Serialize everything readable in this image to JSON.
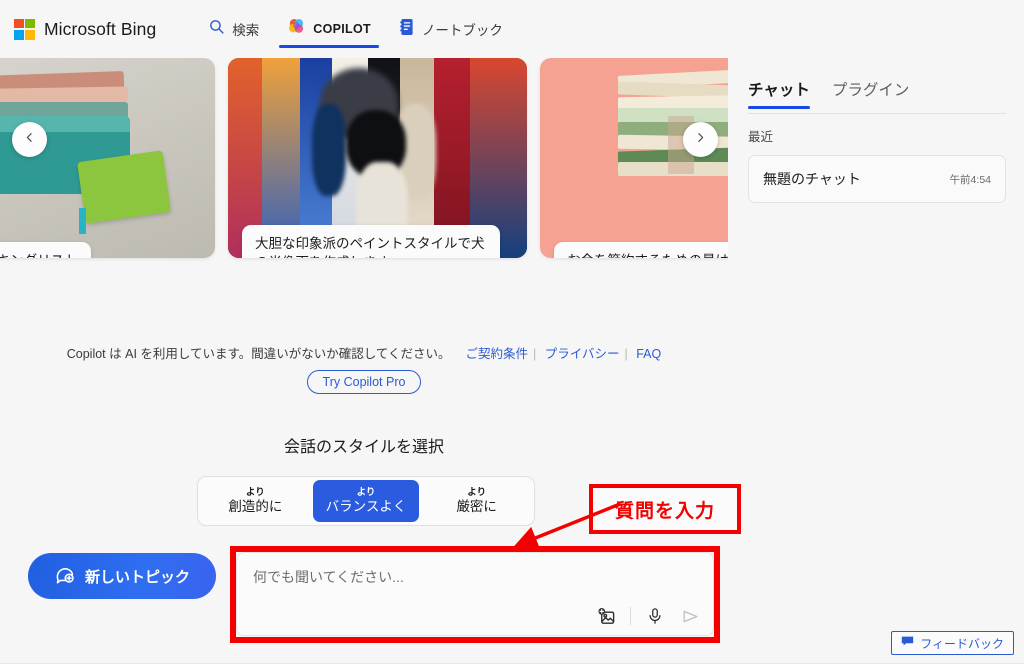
{
  "header": {
    "brand": "Microsoft Bing",
    "tabs": [
      {
        "label": "検索",
        "icon": "search-icon",
        "active": false
      },
      {
        "label": "COPILOT",
        "icon": "copilot-icon",
        "active": true
      },
      {
        "label": "ノートブック",
        "icon": "notebook-icon",
        "active": false
      }
    ]
  },
  "carousel": {
    "prev_icon": "chevron-left-icon",
    "next_icon": "chevron-right-icon",
    "cards": [
      {
        "caption": "行のパッキングリスト",
        "art": "books-desk"
      },
      {
        "caption": "大胆な印象派のペイントスタイルで犬の肖像画を作成します",
        "art": "impressionist-painting"
      },
      {
        "caption": "お金を節約するための最は何ですか",
        "art": "money-stack"
      }
    ]
  },
  "right_panel": {
    "tabs": [
      {
        "label": "チャット",
        "active": true
      },
      {
        "label": "プラグイン",
        "active": false
      }
    ],
    "recent_label": "最近",
    "chats": [
      {
        "title": "無題のチャット",
        "time": "午前4:54"
      }
    ]
  },
  "disclaimer": {
    "text": "Copilot は AI を利用しています。間違いがないか確認してください。",
    "links": [
      "ご契約条件",
      "プライバシー",
      "FAQ"
    ],
    "pro_button": "Try Copilot Pro"
  },
  "style_picker": {
    "title": "会話のスタイルを選択",
    "options": [
      {
        "top": "より",
        "bottom": "創造的に",
        "selected": false
      },
      {
        "top": "より",
        "bottom": "バランスよく",
        "selected": true
      },
      {
        "top": "より",
        "bottom": "厳密に",
        "selected": false
      }
    ]
  },
  "composer": {
    "new_topic_label": "新しいトピック",
    "new_topic_icon": "chat-plus-icon",
    "placeholder": "何でも聞いてください...",
    "value": "",
    "tools": [
      {
        "name": "image-upload-icon"
      },
      {
        "name": "microphone-icon"
      },
      {
        "name": "send-icon"
      }
    ]
  },
  "annotation": {
    "label": "質問を入力",
    "color": "#f50000"
  },
  "feedback": {
    "label": "フィードバック",
    "icon": "feedback-icon",
    "color": "#2b5ad6"
  },
  "colors": {
    "accent": "#174ae4",
    "link": "#2b5ad6",
    "selected_style": "#2b5ce0",
    "background": "#f6f6f6",
    "annotation_red": "#f50000"
  }
}
